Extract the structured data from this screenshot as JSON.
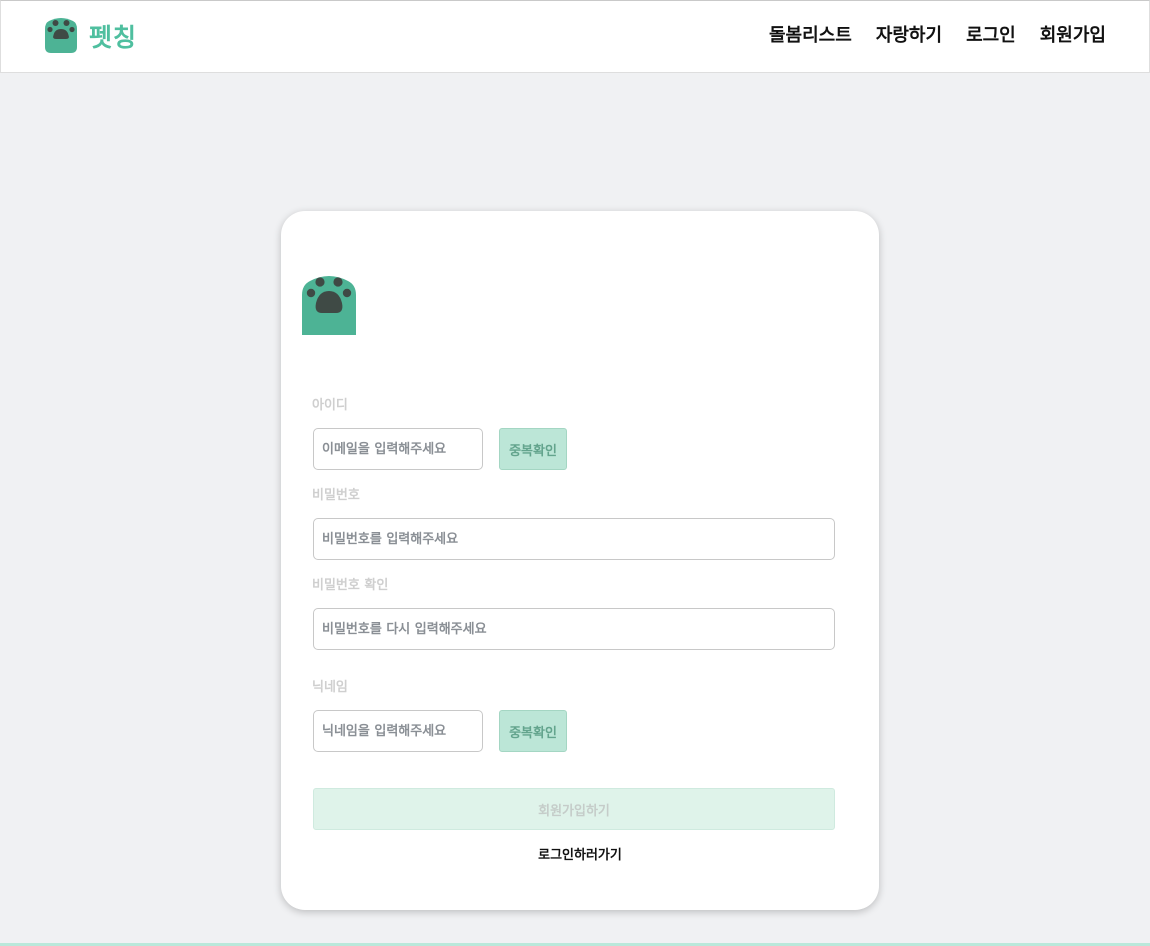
{
  "header": {
    "brand": "펫칭",
    "brand_icon": "paw-icon",
    "nav": {
      "care_list": "돌봄리스트",
      "boast": "자랑하기",
      "login": "로그인",
      "signup": "회원가입"
    }
  },
  "form": {
    "logo_icon": "paw-icon",
    "id": {
      "label": "아이디",
      "placeholder": "이메일을 입력해주세요",
      "check_button": "중복확인"
    },
    "password": {
      "label": "비밀번호",
      "placeholder": "비밀번호를 입력해주세요"
    },
    "password_confirm": {
      "label": "비밀번호 확인",
      "placeholder": "비밀번호를 다시 입력해주세요"
    },
    "nickname": {
      "label": "닉네임",
      "placeholder": "닉네임을 입력해주세요",
      "check_button": "중복확인"
    },
    "submit_label": "회원가입하기",
    "login_link": "로그인하러가기"
  },
  "colors": {
    "brand": "#4fbf9f",
    "paw_body": "#4db395",
    "paw_pad": "#3f4a45",
    "page_bg": "#f0f1f3"
  }
}
